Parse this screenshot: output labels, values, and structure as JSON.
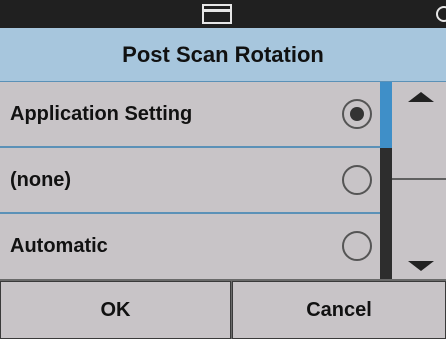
{
  "status_bar": {
    "scanner_icon": "scanner-icon",
    "edge_icon": "partial-icon"
  },
  "dialog": {
    "title": "Post Scan Rotation"
  },
  "options": [
    {
      "label": "Application Setting",
      "selected": true
    },
    {
      "label": "(none)",
      "selected": false
    },
    {
      "label": "Automatic",
      "selected": false
    }
  ],
  "scroll": {
    "up_icon": "arrow-up-icon",
    "down_icon": "arrow-down-icon"
  },
  "footer": {
    "ok_label": "OK",
    "cancel_label": "Cancel"
  },
  "colors": {
    "accent": "#3f8fc8",
    "title_bg": "#a7c6dd",
    "status_bar": "#202020",
    "surface": "#c8c4c7"
  }
}
